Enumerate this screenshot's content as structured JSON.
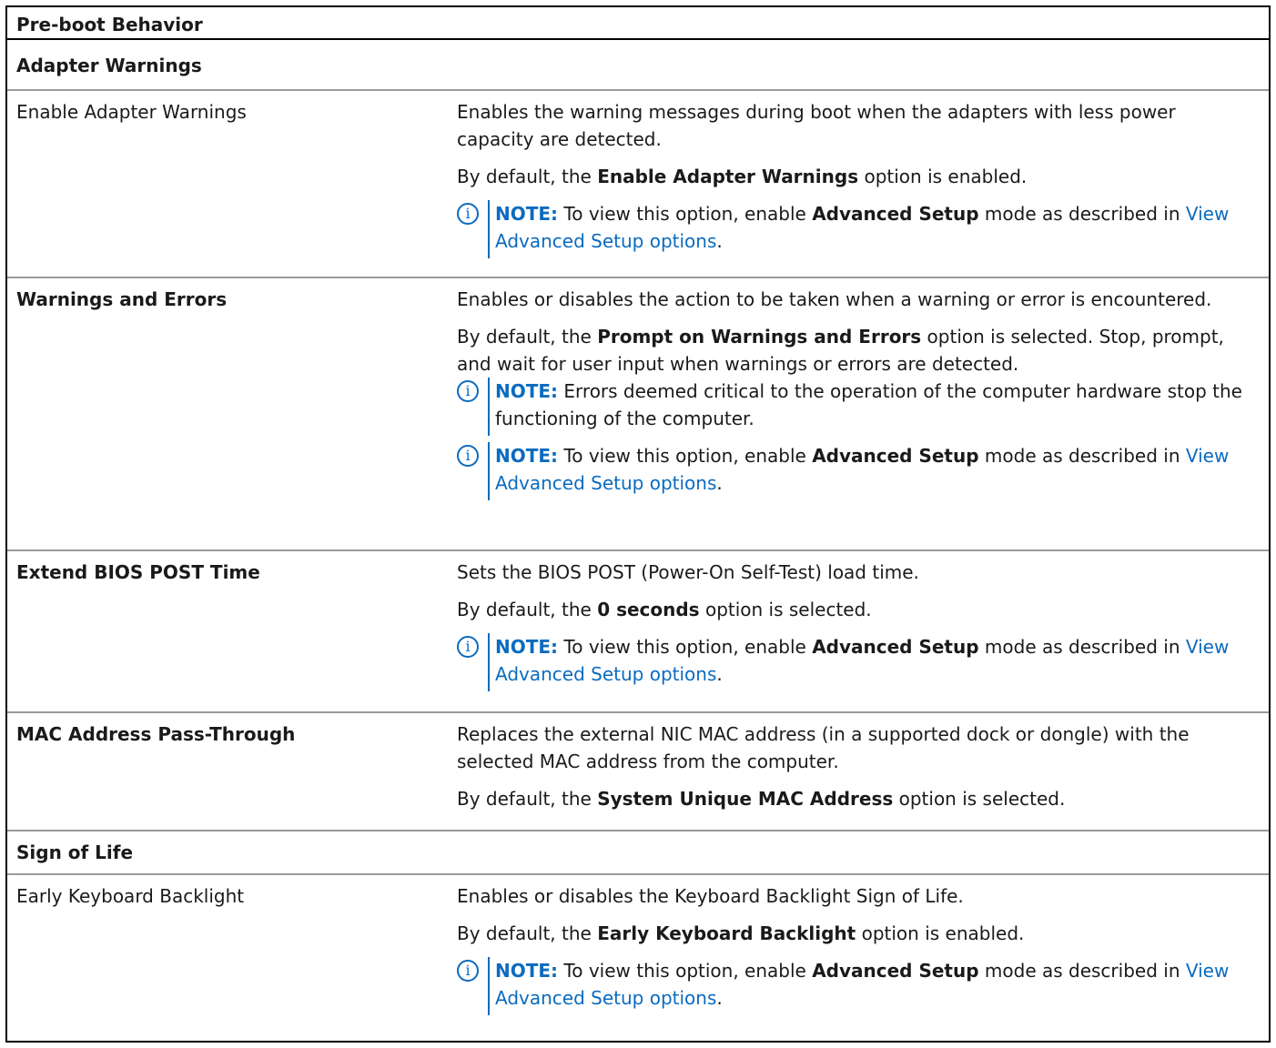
{
  "title": "Pre-boot Behavior",
  "sections": {
    "adapter_warnings": "Adapter Warnings",
    "sign_of_life": "Sign of Life"
  },
  "rows": {
    "enable_adapter_warnings": {
      "label": "Enable Adapter Warnings",
      "desc": "Enables the warning messages during boot when the adapters with less power capacity are detected.",
      "default_pre": "By default, the ",
      "default_bold": "Enable Adapter Warnings",
      "default_post": " option is enabled."
    },
    "warnings_and_errors": {
      "label": "Warnings and Errors",
      "desc": "Enables or disables the action to be taken when a warning or error is encountered.",
      "default_pre": "By default, the ",
      "default_bold": "Prompt on Warnings and Errors",
      "default_post": " option is selected. Stop, prompt, and wait for user input when warnings or errors are detected.",
      "note_critical": " Errors deemed critical to the operation of the computer hardware stop the functioning of the computer."
    },
    "extend_bios_post_time": {
      "label": "Extend BIOS POST Time",
      "desc": "Sets the BIOS POST (Power-On Self-Test) load time.",
      "default_pre": "By default, the ",
      "default_bold": "0 seconds",
      "default_post": " option is selected."
    },
    "mac_pass_through": {
      "label": "MAC Address Pass-Through",
      "desc": "Replaces the external NIC MAC address (in a supported dock or dongle) with the selected MAC address from the computer.",
      "default_pre": "By default, the ",
      "default_bold": "System Unique MAC Address",
      "default_post": " option is selected."
    },
    "early_keyboard_backlight": {
      "label": "Early Keyboard Backlight",
      "desc": "Enables or disables the Keyboard Backlight Sign of Life.",
      "default_pre": "By default, the ",
      "default_bold": "Early Keyboard Backlight",
      "default_post": " option is enabled."
    }
  },
  "note": {
    "label": "NOTE:",
    "pre": " To view this option, enable ",
    "bold": "Advanced Setup",
    "mid": " mode as described in ",
    "link": "View Advanced Setup options",
    "end": "."
  },
  "icon": "info-icon",
  "colors": {
    "accent": "#0b6bbf"
  }
}
